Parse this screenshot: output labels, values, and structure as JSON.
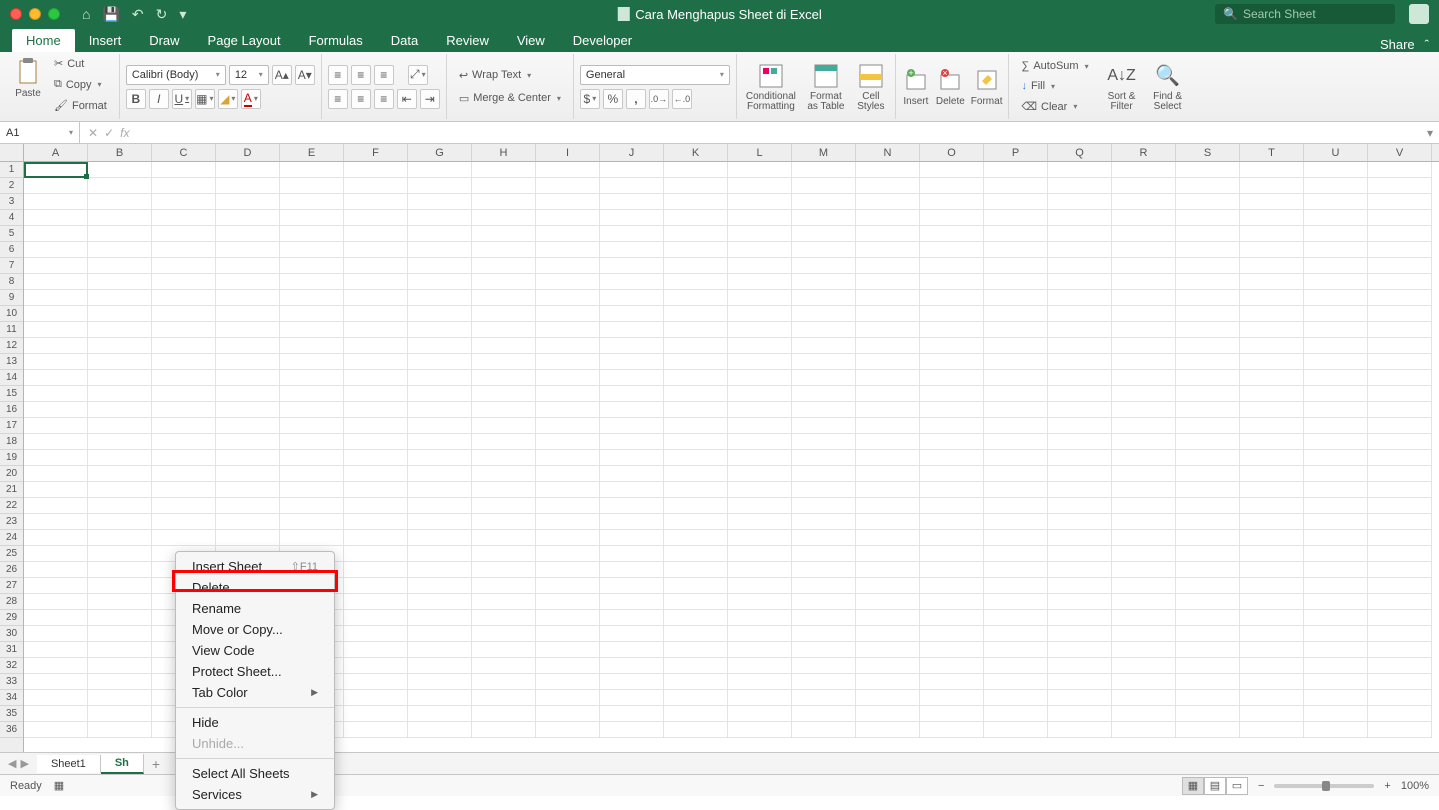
{
  "titlebar": {
    "title": "Cara Menghapus Sheet di Excel",
    "search_placeholder": "Search Sheet"
  },
  "tabs": [
    "Home",
    "Insert",
    "Draw",
    "Page Layout",
    "Formulas",
    "Data",
    "Review",
    "View",
    "Developer"
  ],
  "share": "Share",
  "ribbon": {
    "paste": "Paste",
    "cut": "Cut",
    "copy": "Copy",
    "format_painter": "Format",
    "font_name": "Calibri (Body)",
    "font_size": "12",
    "wrap": "Wrap Text",
    "merge": "Merge & Center",
    "num_format": "General",
    "cond_fmt": "Conditional Formatting",
    "fmt_table": "Format as Table",
    "cell_styles": "Cell Styles",
    "insert": "Insert",
    "delete": "Delete",
    "format": "Format",
    "autosum": "AutoSum",
    "fill": "Fill",
    "clear": "Clear",
    "sort": "Sort & Filter",
    "find": "Find & Select"
  },
  "namebox": "A1",
  "columns": [
    "A",
    "B",
    "C",
    "D",
    "E",
    "F",
    "G",
    "H",
    "I",
    "J",
    "K",
    "L",
    "M",
    "N",
    "O",
    "P",
    "Q",
    "R",
    "S",
    "T",
    "U",
    "V"
  ],
  "row_count": 36,
  "sheets": [
    "Sheet1",
    "Sh"
  ],
  "status": {
    "ready": "Ready",
    "zoom": "100%"
  },
  "ctx": {
    "insert_sheet": "Insert Sheet",
    "insert_shortcut": "⇧F11",
    "delete": "Delete",
    "rename": "Rename",
    "move_copy": "Move or Copy...",
    "view_code": "View Code",
    "protect": "Protect Sheet...",
    "tab_color": "Tab Color",
    "hide": "Hide",
    "unhide": "Unhide...",
    "select_all": "Select All Sheets",
    "services": "Services"
  }
}
